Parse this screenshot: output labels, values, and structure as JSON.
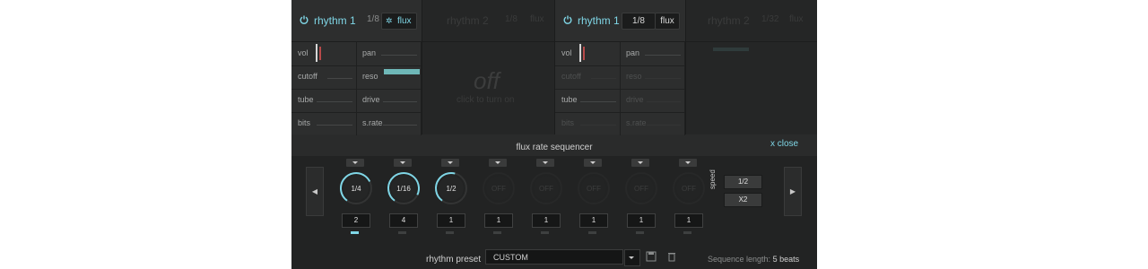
{
  "panels": [
    {
      "name": "rhythm 1",
      "division": "1/8",
      "flux": "flux",
      "params": [
        "vol",
        "pan",
        "cutoff",
        "reso",
        "tube",
        "drive",
        "bits",
        "s.rate"
      ]
    },
    {
      "name": "rhythm 2",
      "division": "1/8",
      "flux": "flux",
      "off_text": "off",
      "off_sub": "click to turn on"
    },
    {
      "name": "rhythm 1",
      "division": "1/8",
      "flux": "flux",
      "params": [
        "vol",
        "pan",
        "cutoff",
        "reso",
        "tube",
        "drive",
        "bits",
        "s.rate"
      ]
    },
    {
      "name": "rhythm 2",
      "division": "1/32",
      "flux": "flux"
    }
  ],
  "sequencer": {
    "title": "flux rate sequencer",
    "close_label": "x close",
    "prev": "◀",
    "next": "▶",
    "steps": [
      {
        "rate": "1/4",
        "beats": "2",
        "active": true,
        "fill": 0.72
      },
      {
        "rate": "1/16",
        "beats": "4",
        "active": false,
        "fill": 0.9
      },
      {
        "rate": "1/2",
        "beats": "1",
        "active": false,
        "fill": 0.55
      },
      {
        "rate": "OFF",
        "beats": "1",
        "active": false,
        "fill": 0
      },
      {
        "rate": "OFF",
        "beats": "1",
        "active": false,
        "fill": 0
      },
      {
        "rate": "OFF",
        "beats": "1",
        "active": false,
        "fill": 0
      },
      {
        "rate": "OFF",
        "beats": "1",
        "active": false,
        "fill": 0
      },
      {
        "rate": "OFF",
        "beats": "1",
        "active": false,
        "fill": 0
      }
    ],
    "speed_label": "speed",
    "speed_half": "1/2",
    "speed_double": "X2"
  },
  "bottom": {
    "preset_label": "rhythm preset",
    "preset_value": "CUSTOM",
    "seq_length_label": "Sequence length:",
    "seq_length_value": "5 beats"
  },
  "colors": {
    "accent": "#7fd6e6",
    "bg": "#2a2b2b",
    "dark": "#161717"
  }
}
